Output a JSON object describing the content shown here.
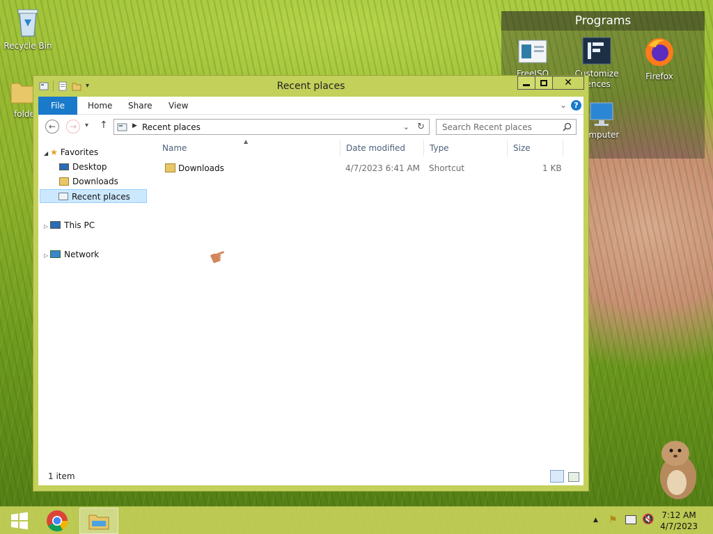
{
  "desktop": {
    "icons": [
      {
        "label": "Recycle Bin"
      },
      {
        "label": "folde"
      }
    ],
    "fence": {
      "title": "Programs",
      "items": [
        {
          "label": "FreeISO"
        },
        {
          "label": "Customize fences"
        },
        {
          "label": "Firefox"
        },
        {
          "label": "omputer"
        }
      ]
    }
  },
  "window": {
    "title": "Recent places",
    "controls": {
      "minimize": "–",
      "maximize": "□",
      "close": "✕"
    },
    "ribbon": {
      "tabs": [
        "File",
        "Home",
        "Share",
        "View"
      ]
    },
    "address": {
      "path": "Recent places",
      "search_placeholder": "Search Recent places"
    },
    "nav": {
      "favorites": "Favorites",
      "desktop": "Desktop",
      "downloads": "Downloads",
      "recent": "Recent places",
      "this_pc": "This PC",
      "network": "Network"
    },
    "columns": {
      "name": "Name",
      "date": "Date modified",
      "type": "Type",
      "size": "Size"
    },
    "rows": [
      {
        "name": "Downloads",
        "date": "4/7/2023 6:41 AM",
        "type": "Shortcut",
        "size": "1 KB"
      }
    ],
    "status": "1 item"
  },
  "taskbar": {
    "time": "7:12 AM",
    "date": "4/7/2023"
  }
}
